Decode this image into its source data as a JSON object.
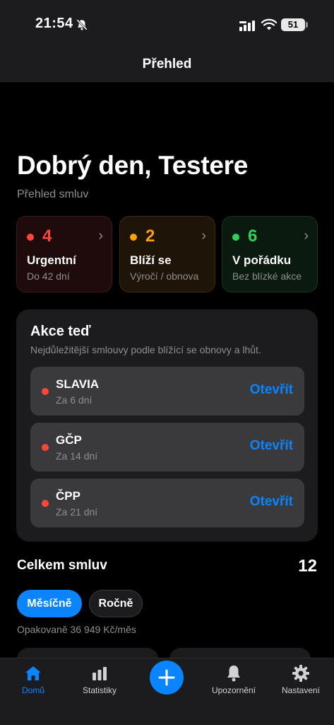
{
  "status": {
    "time": "21:54",
    "battery": "51"
  },
  "nav": {
    "title": "Přehled"
  },
  "header": {
    "greeting": "Dobrý den, Testere",
    "subtitle": "Přehled smluv"
  },
  "summary": [
    {
      "count": "4",
      "label": "Urgentní",
      "hint": "Do 42 dní",
      "color": "#ff453a"
    },
    {
      "count": "2",
      "label": "Blíží se",
      "hint": "Výročí / obnova",
      "color": "#ff9f0a"
    },
    {
      "count": "6",
      "label": "V pořádku",
      "hint": "Bez blízké akce",
      "color": "#30d158"
    }
  ],
  "actions": {
    "title": "Akce teď",
    "description": "Nejdůležitější smlouvy podle blížící se obnovy a lhůt.",
    "items": [
      {
        "name": "SLAVIA",
        "due": "Za 6 dní",
        "button": "Otevřít"
      },
      {
        "name": "GČP",
        "due": "Za 14 dní",
        "button": "Otevřít"
      },
      {
        "name": "ČPP",
        "due": "Za 21 dní",
        "button": "Otevřít"
      }
    ]
  },
  "totals": {
    "label": "Celkem smluv",
    "value": "12",
    "segments": {
      "monthly": "Měsíčně",
      "yearly": "Ročně"
    },
    "recurring": "Opakovaně 36 949 Kč/měs"
  },
  "tabbar": {
    "home": "Domů",
    "stats": "Statistiky",
    "notifications": "Upozornění",
    "settings": "Nastavení"
  },
  "colors": {
    "accent": "#0a84ff",
    "urgent": "#ff453a",
    "soon": "#ff9f0a",
    "ok": "#30d158"
  },
  "icons": [
    "bell-slash-icon",
    "signal-icon",
    "wifi-icon",
    "battery-icon",
    "chevron-right-icon",
    "house-icon",
    "chart-bar-icon",
    "plus-icon",
    "bell-icon",
    "gear-icon"
  ]
}
